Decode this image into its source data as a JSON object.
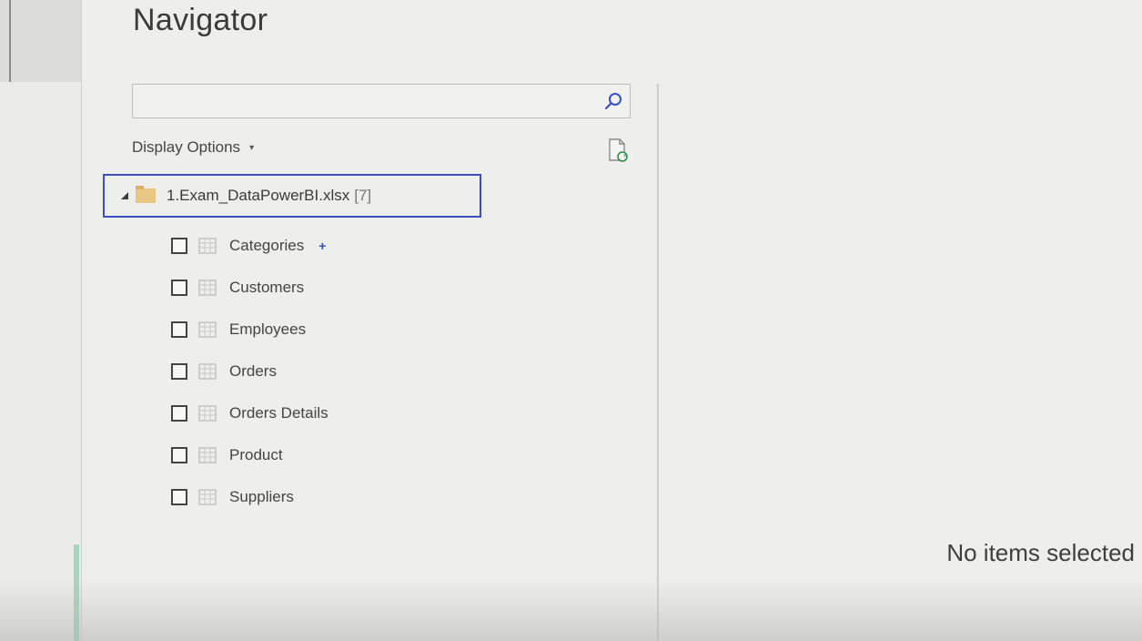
{
  "dialog": {
    "title": "Navigator"
  },
  "search": {
    "value": "",
    "placeholder": "",
    "icon": "search-icon"
  },
  "display_options": {
    "label": "Display Options",
    "caret": "▾"
  },
  "refresh": {
    "icon": "refresh-file-icon"
  },
  "tree": {
    "root": {
      "label": "1.Exam_DataPowerBI.xlsx",
      "count": "[7]",
      "icon": "folder-icon",
      "expanded": true,
      "highlight_color": "#3a4fc0"
    },
    "items": [
      {
        "label": "Categories",
        "checked": false,
        "icon": "table-icon",
        "hover_add": "+"
      },
      {
        "label": "Customers",
        "checked": false,
        "icon": "table-icon"
      },
      {
        "label": "Employees",
        "checked": false,
        "icon": "table-icon"
      },
      {
        "label": "Orders",
        "checked": false,
        "icon": "table-icon"
      },
      {
        "label": "Orders Details",
        "checked": false,
        "icon": "table-icon"
      },
      {
        "label": "Product",
        "checked": false,
        "icon": "table-icon"
      },
      {
        "label": "Suppliers",
        "checked": false,
        "icon": "table-icon"
      }
    ]
  },
  "preview": {
    "empty_message": "No items selected"
  },
  "colors": {
    "dialog_bg": "#eeeeec",
    "accent": "#3a4fc0",
    "folder": "#e8c683",
    "side_accent": "#a9d4bf"
  }
}
